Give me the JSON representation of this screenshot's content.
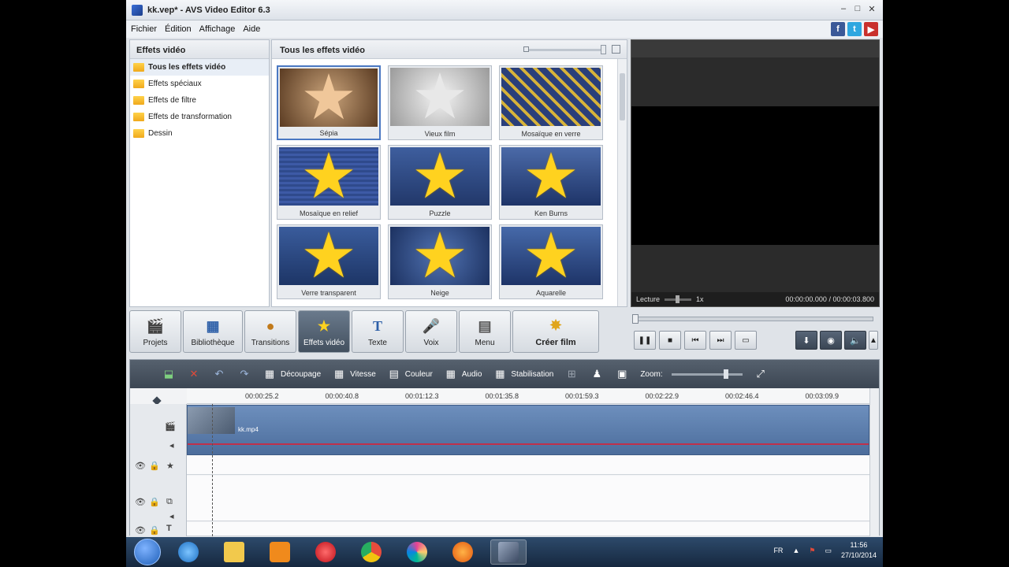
{
  "window": {
    "title": "kk.vep* - AVS Video Editor 6.3",
    "controls": [
      "–",
      "□",
      "✕"
    ]
  },
  "menu": [
    "Fichier",
    "Édition",
    "Affichage",
    "Aide"
  ],
  "social": [
    "f",
    "t",
    "▶"
  ],
  "effects_tree": {
    "header": "Effets vidéo",
    "items": [
      "Tous les effets vidéo",
      "Effets spéciaux",
      "Effets de filtre",
      "Effets de transformation",
      "Dessin"
    ]
  },
  "effects_grid": {
    "header": "Tous les effets vidéo",
    "tiles": [
      {
        "label": "Sépia",
        "style": "sepia"
      },
      {
        "label": "Vieux film",
        "style": "oldfilm"
      },
      {
        "label": "Mosaïque en verre",
        "style": "glass"
      },
      {
        "label": "Mosaïque en relief",
        "style": "relief"
      },
      {
        "label": "Puzzle",
        "style": "puzzle"
      },
      {
        "label": "Ken Burns",
        "style": "kenburns"
      },
      {
        "label": "Verre transparent",
        "style": "transparent"
      },
      {
        "label": "Neige",
        "style": "snow"
      },
      {
        "label": "Aquarelle",
        "style": "aquarelle"
      }
    ]
  },
  "preview": {
    "status_label": "Lecture",
    "speed": "1x",
    "time": "00:00:00.000 / 00:00:03.800"
  },
  "toolbar": {
    "buttons": [
      "Projets",
      "Bibliothèque",
      "Transitions",
      "Effets vidéo",
      "Texte",
      "Voix",
      "Menu"
    ],
    "create": "Créer film"
  },
  "timeline": {
    "tools": [
      "Découpage",
      "Vitesse",
      "Couleur",
      "Audio",
      "Stabilisation"
    ],
    "zoom_label": "Zoom:",
    "ruler": [
      "00:00:25.2",
      "00:00:40.8",
      "00:01:12.3",
      "00:01:35.8",
      "00:01:59.3",
      "00:02:22.9",
      "00:02:46.4",
      "00:03:09.9"
    ],
    "clip_label": "kk.mp4"
  },
  "taskbar": {
    "lang": "FR",
    "time": "11:56",
    "date": "27/10/2014"
  },
  "colors": {
    "accent": "#4a78c2",
    "star": "#ffd21f",
    "track": "#5b7cab"
  }
}
